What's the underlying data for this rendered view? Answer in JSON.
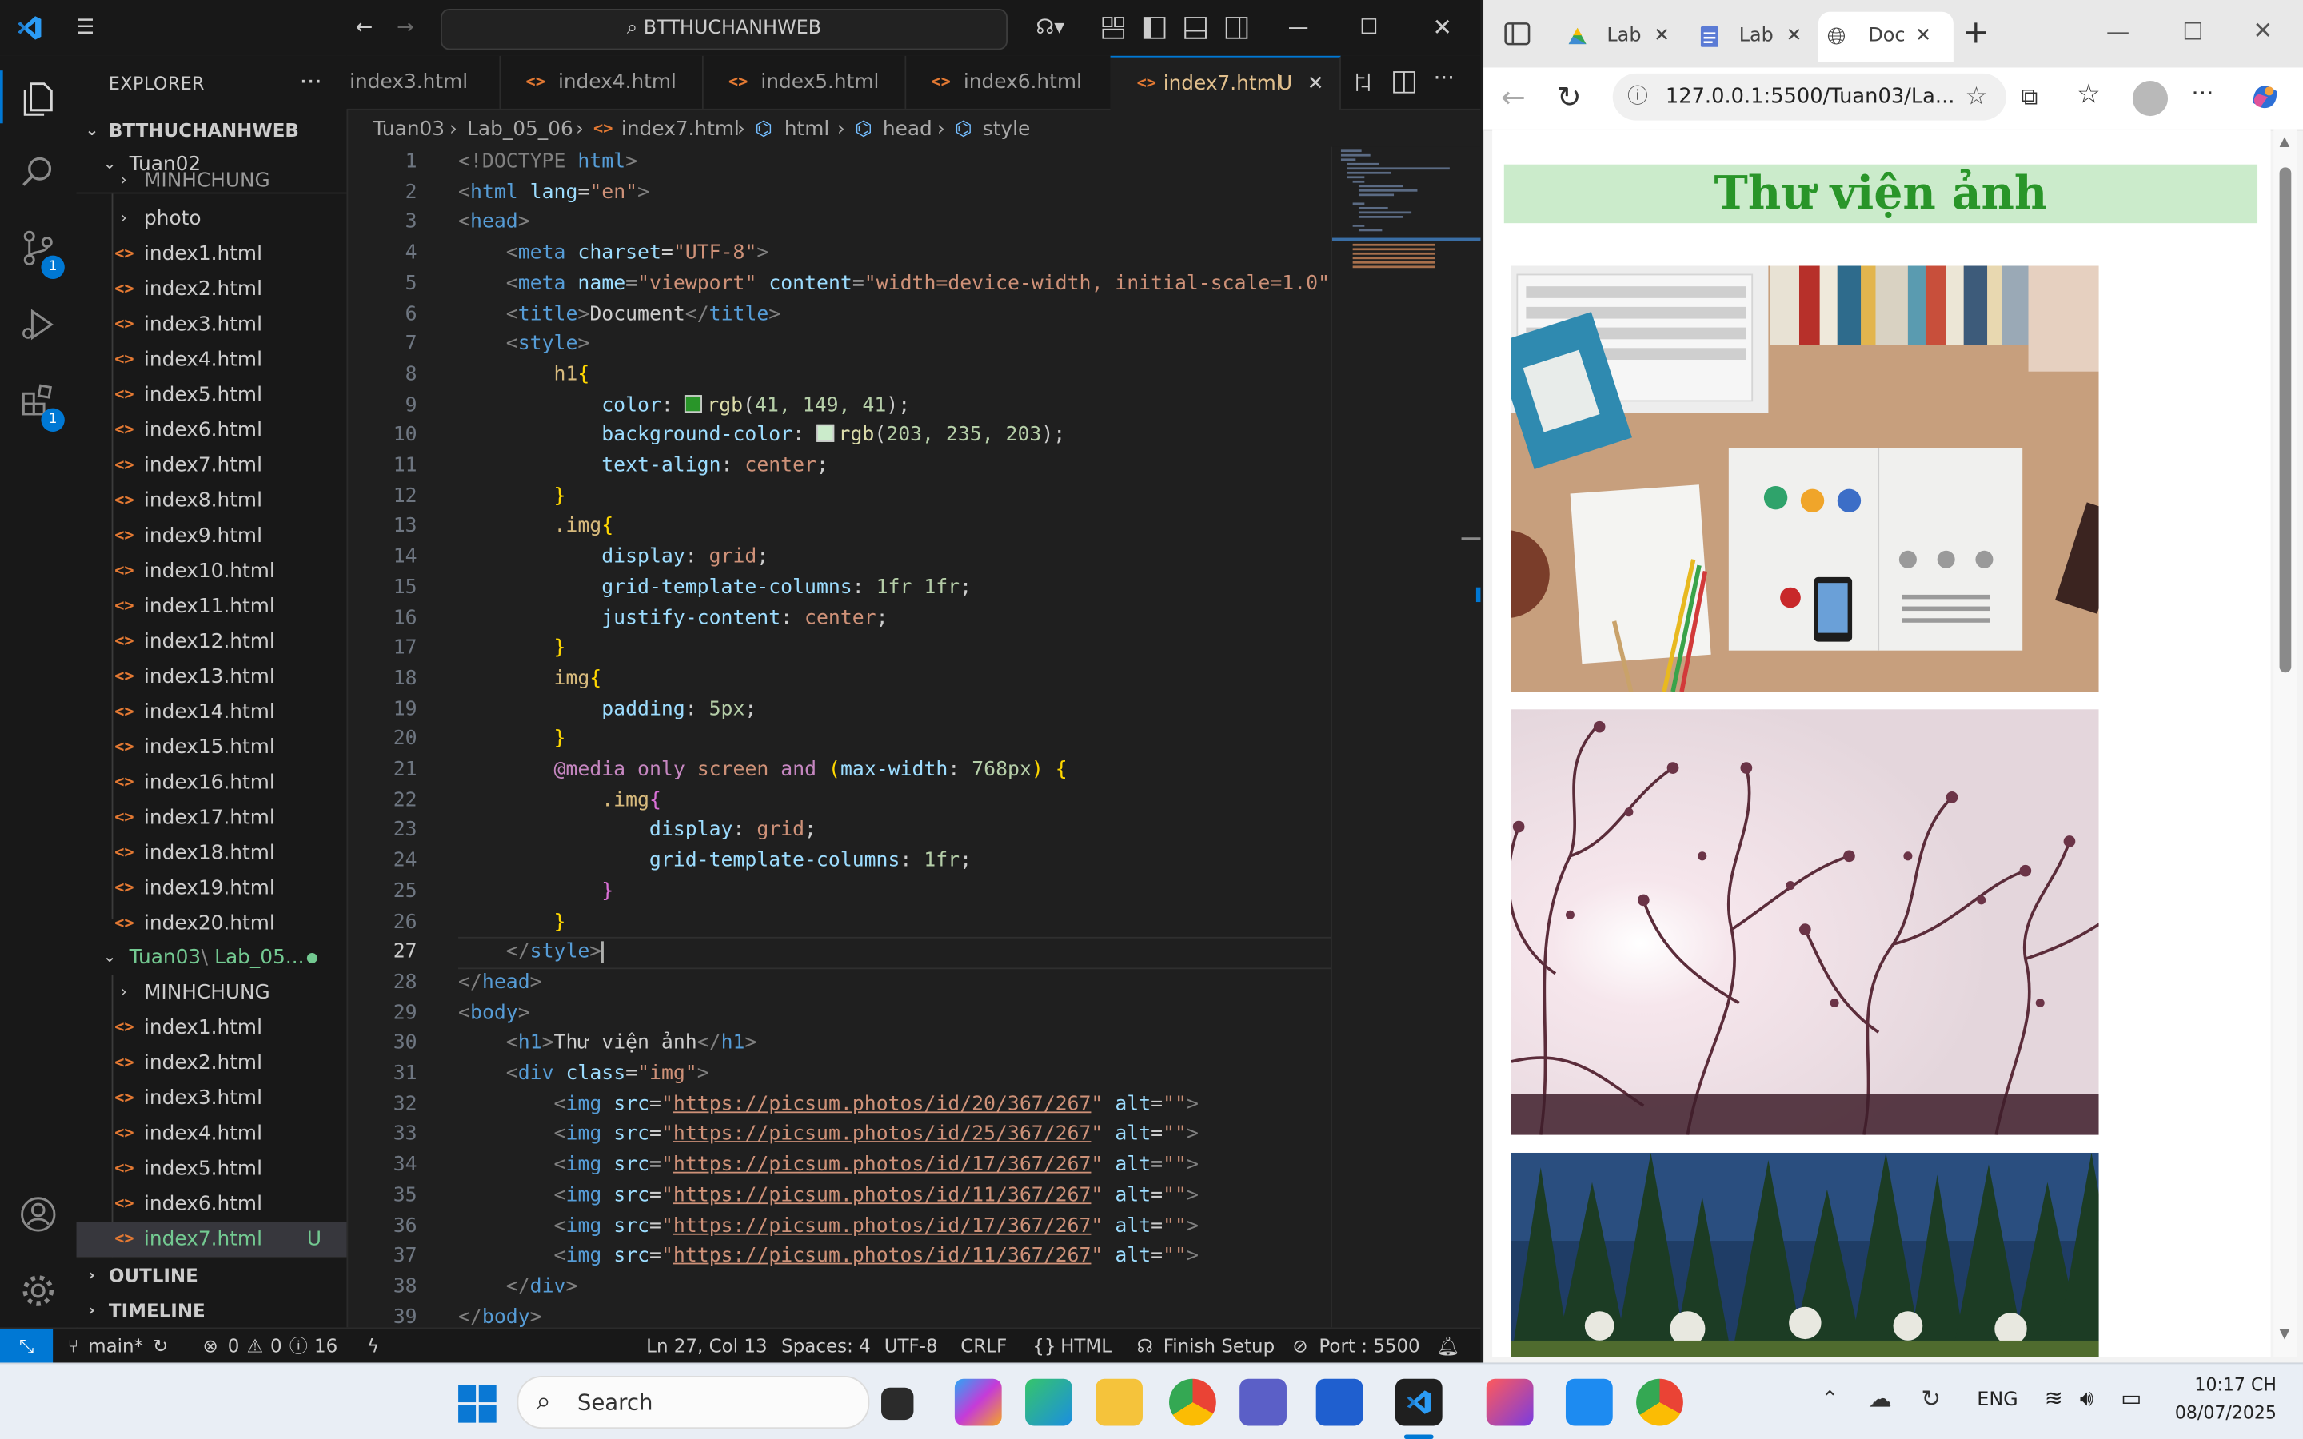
{
  "vscode": {
    "search_text": "BTTHUCHANHWEB",
    "explorer_title": "EXPLORER",
    "activity_badges": {
      "scm": "1",
      "extensions": "1"
    },
    "tree": {
      "root": "BTTHUCHANHWEB",
      "tuan02": "Tuan02",
      "minhchung_partial": "MINHCHUNG",
      "photo": "photo",
      "tuan02_files": [
        "index1.html",
        "index2.html",
        "index3.html",
        "index4.html",
        "index5.html",
        "index6.html",
        "index7.html",
        "index8.html",
        "index9.html",
        "index10.html",
        "index11.html",
        "index12.html",
        "index13.html",
        "index14.html",
        "index15.html",
        "index16.html",
        "index17.html",
        "index18.html",
        "index19.html",
        "index20.html"
      ],
      "tuan03_a": "Tuan03",
      "tuan03_sep": "\\",
      "tuan03_b": "Lab_05...",
      "minhchung": "MINHCHUNG",
      "tuan03_files": [
        "index1.html",
        "index2.html",
        "index3.html",
        "index4.html",
        "index5.html",
        "index6.html"
      ],
      "active_file": "index7.html",
      "active_status": "U"
    },
    "outline": "OUTLINE",
    "timeline": "TIMELINE",
    "tabs": [
      "index3.html",
      "index4.html",
      "index5.html",
      "index6.html",
      "index7.html"
    ],
    "active_tab_status": "U",
    "breadcrumb": [
      "Tuan03",
      "Lab_05_06",
      "index7.html",
      "html",
      "head",
      "style"
    ],
    "line_numbers": [
      "1",
      "2",
      "3",
      "4",
      "5",
      "6",
      "7",
      "8",
      "9",
      "10",
      "11",
      "12",
      "13",
      "14",
      "15",
      "16",
      "17",
      "18",
      "19",
      "20",
      "21",
      "22",
      "23",
      "24",
      "25",
      "26",
      "27",
      "28",
      "29",
      "30",
      "31",
      "32",
      "33",
      "34",
      "35",
      "36",
      "37",
      "38",
      "39"
    ],
    "code": {
      "l1a": "<!DOCTYPE ",
      "l1b": "html",
      "l1c": ">",
      "l2_tag": "html",
      "l2_attr": "lang",
      "l2_val": "\"en\"",
      "l3_tag": "head",
      "l4_tag": "meta",
      "l4_attr": "charset",
      "l4_val": "\"UTF-8\"",
      "l5_tag": "meta",
      "l5_attr1": "name",
      "l5_val1": "\"viewport\"",
      "l5_attr2": "content",
      "l5_val2": "\"width=device-width, initial-scale=1.0\"",
      "l6_tag": "title",
      "l6_text": "Document",
      "l7_tag": "style",
      "l8_sel": "h1",
      "l9_prop": "color",
      "l9_fn": "rgb",
      "l9_args": "41, 149, 41",
      "l10_prop": "background-color",
      "l10_fn": "rgb",
      "l10_args": "203, 235, 203",
      "l11_prop": "text-align",
      "l11_val": "center",
      "l13_sel": ".img",
      "l14_prop": "display",
      "l14_val": "grid",
      "l15_prop": "grid-template-columns",
      "l15_val": "1fr 1fr",
      "l16_prop": "justify-content",
      "l16_val": "center",
      "l18_sel": "img",
      "l19_prop": "padding",
      "l19_val": "5px",
      "l21_at": "@media",
      "l21_only": "only",
      "l21_screen": "screen",
      "l21_and": "and",
      "l21_feat": "max-width",
      "l21_num": "768px",
      "l22_sel": ".img",
      "l23_prop": "display",
      "l23_val": "grid",
      "l24_prop": "grid-template-columns",
      "l24_val": "1fr",
      "l27_tag": "style",
      "l28_tag": "head",
      "l29_tag": "body",
      "l30_tag": "h1",
      "l30_text": "Thư viện ảnh",
      "l31_tag": "div",
      "l31_attr": "class",
      "l31_val": "\"img\"",
      "img_tag": "img",
      "img_src": "src",
      "img_alt": "alt",
      "img_empty": "\"\"",
      "img_urls": [
        "https://picsum.photos/id/20/367/267",
        "https://picsum.photos/id/25/367/267",
        "https://picsum.photos/id/17/367/267",
        "https://picsum.photos/id/11/367/267",
        "https://picsum.photos/id/17/367/267",
        "https://picsum.photos/id/11/367/267"
      ],
      "l38_tag": "div",
      "l39_tag": "body"
    },
    "status": {
      "branch": "main*",
      "errors": "0",
      "warnings": "0",
      "info": "16",
      "cursor": "Ln 27, Col 13",
      "spaces": "Spaces: 4",
      "encoding": "UTF-8",
      "eol": "CRLF",
      "language": "HTML",
      "finish_setup": "Finish Setup",
      "port": "Port : 5500"
    }
  },
  "browser": {
    "tabs": [
      "Lab",
      "Lab",
      "Doc"
    ],
    "address": "127.0.0.1:5500/Tuan03/La...",
    "page_title": "Thư viện ảnh",
    "heading_color": "#299529",
    "heading_bg": "#cbebcb"
  },
  "taskbar": {
    "search_placeholder": "Search",
    "language": "ENG",
    "time": "10:17 CH",
    "date": "08/07/2025"
  }
}
